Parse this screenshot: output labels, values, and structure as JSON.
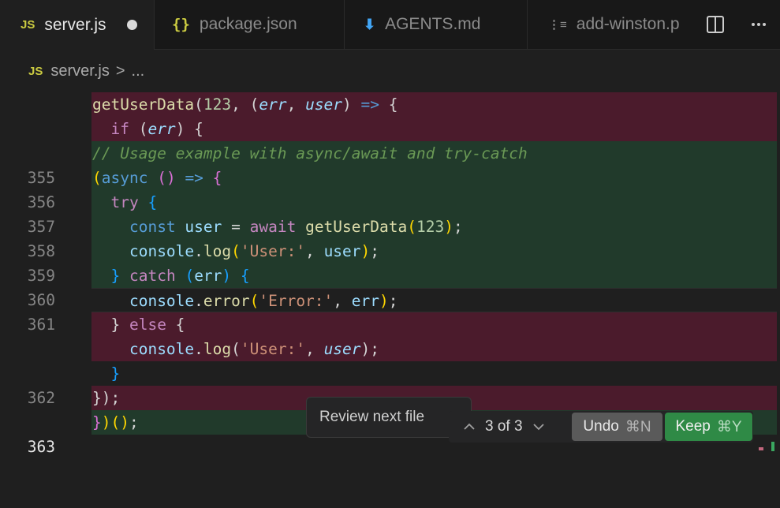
{
  "tabs": [
    {
      "icon": "JS",
      "label": "server.js",
      "active": true,
      "modified": true
    },
    {
      "icon": "{}",
      "label": "package.json"
    },
    {
      "icon": "⬇",
      "label": "AGENTS.md"
    },
    {
      "icon": "⋮≡",
      "label": "add-winston.p"
    }
  ],
  "tab_actions": {
    "split": "◫",
    "more": "···"
  },
  "breadcrumb": {
    "icon": "JS",
    "file": "server.js",
    "separator": ">",
    "more": "..."
  },
  "code": {
    "del1": "getUserData(123, (err, user) => {",
    "del2": "  if (err) {",
    "ins355": {
      "num": "355",
      "text": "// Usage example with async/await and try-catch"
    },
    "ins356": {
      "num": "356"
    },
    "ins357": {
      "num": "357"
    },
    "ins358": {
      "num": "358"
    },
    "ins359": {
      "num": "359"
    },
    "ins360": {
      "num": "360"
    },
    "ctx361": {
      "num": "361"
    },
    "ctx362": {
      "num": "362"
    },
    "ins363": {
      "num": "363"
    },
    "tokens": {
      "const": "const",
      "user": "user",
      "await": "await",
      "getUserData": "getUserData",
      "n123": "123",
      "console": "console",
      "log": "log",
      "error": "error",
      "try": "try",
      "catch": "catch",
      "err": "err",
      "async": "async",
      "else": "else",
      "if": "if",
      "s_user": "'User:'",
      "s_error": "'Error:'"
    }
  },
  "review": {
    "next_file_label": "Review next file",
    "counter": "3 of 3",
    "undo_label": "Undo",
    "undo_shortcut": "⌘N",
    "keep_label": "Keep",
    "keep_shortcut": "⌘Y"
  },
  "colors": {
    "deleted_bg": "#4b1b2c",
    "inserted_bg": "#213a2b",
    "keep_button": "#2f8a46"
  }
}
